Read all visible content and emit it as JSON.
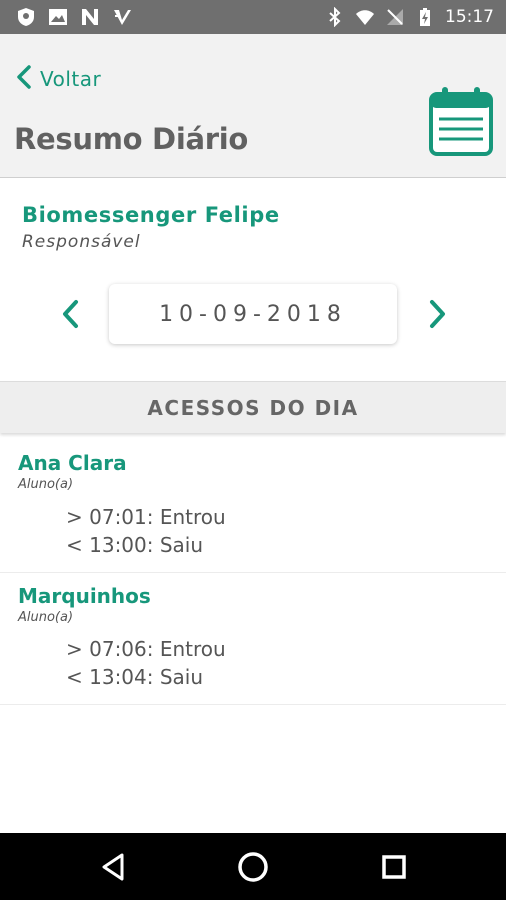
{
  "status_bar": {
    "time": "15:17",
    "left_icons": [
      "shield-icon",
      "image-icon",
      "n-logo-icon",
      "checkmark-badge-icon"
    ],
    "right_icons": [
      "bluetooth-icon",
      "wifi-icon",
      "signal-off-icon",
      "battery-charging-icon"
    ]
  },
  "header": {
    "back_label": "Voltar",
    "title": "Resumo Diário",
    "calendar_icon": "calendar-icon"
  },
  "user": {
    "name": "Biomessenger Felipe",
    "role": "Responsável"
  },
  "date_picker": {
    "value": "10-09-2018"
  },
  "section": {
    "title": "ACESSOS DO DIA"
  },
  "entries": [
    {
      "name": "Ana Clara",
      "role": "Aluno(a)",
      "events": [
        "> 07:01: Entrou",
        "< 13:00: Saiu"
      ]
    },
    {
      "name": "Marquinhos",
      "role": "Aluno(a)",
      "events": [
        "> 07:06: Entrou",
        "< 13:04: Saiu"
      ]
    }
  ],
  "nav_bar": {
    "buttons": [
      "back-triangle-icon",
      "home-circle-icon",
      "recents-square-icon"
    ]
  },
  "colors": {
    "accent": "#17977b",
    "status_bar": "#6f6f6f",
    "header_bg": "#f2f2f2",
    "text": "#555555"
  }
}
